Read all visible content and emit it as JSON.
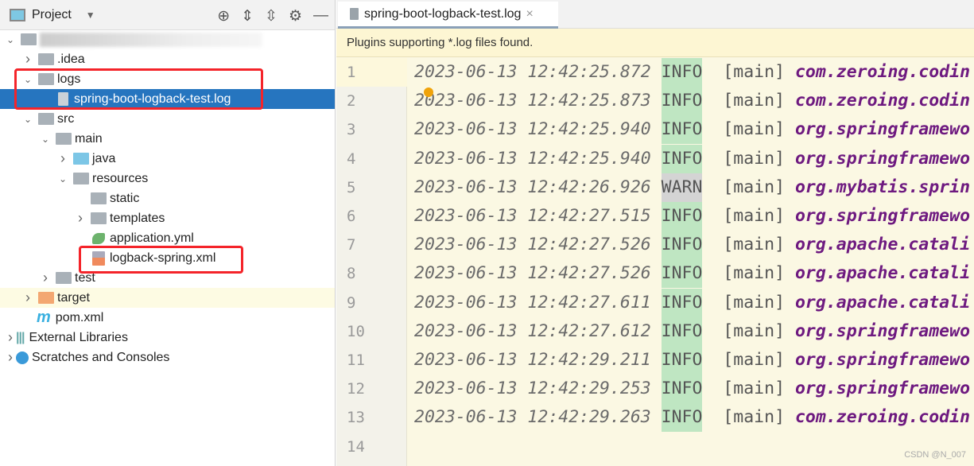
{
  "project": {
    "title": "Project",
    "tools": [
      "locate-icon",
      "expand-all-icon",
      "collapse-all-icon",
      "gear-icon",
      "minimize-icon"
    ],
    "tree": [
      {
        "label": "",
        "depth": 0,
        "chev": "down",
        "icon": "module",
        "blurred": true
      },
      {
        "label": ".idea",
        "depth": 1,
        "chev": "right",
        "icon": "folder"
      },
      {
        "label": "logs",
        "depth": 1,
        "chev": "down",
        "icon": "folder"
      },
      {
        "label": "spring-boot-logback-test.log",
        "depth": 2,
        "chev": "",
        "icon": "file",
        "selected": true
      },
      {
        "label": "src",
        "depth": 1,
        "chev": "down",
        "icon": "folder"
      },
      {
        "label": "main",
        "depth": 2,
        "chev": "down",
        "icon": "folder"
      },
      {
        "label": "java",
        "depth": 3,
        "chev": "right",
        "icon": "folder-blue"
      },
      {
        "label": "resources",
        "depth": 3,
        "chev": "down",
        "icon": "folder-resources"
      },
      {
        "label": "static",
        "depth": 4,
        "chev": "",
        "icon": "folder"
      },
      {
        "label": "templates",
        "depth": 4,
        "chev": "right",
        "icon": "folder"
      },
      {
        "label": "application.yml",
        "depth": 4,
        "chev": "",
        "icon": "spring-yml"
      },
      {
        "label": "logback-spring.xml",
        "depth": 4,
        "chev": "",
        "icon": "xml"
      },
      {
        "label": "test",
        "depth": 2,
        "chev": "right",
        "icon": "folder"
      },
      {
        "label": "target",
        "depth": 1,
        "chev": "right",
        "icon": "folder-orange",
        "highlight": true
      },
      {
        "label": "pom.xml",
        "depth": 1,
        "chev": "",
        "icon": "maven"
      },
      {
        "label": "External Libraries",
        "depth": 0,
        "chev": "right",
        "icon": "libraries"
      },
      {
        "label": "Scratches and Consoles",
        "depth": 0,
        "chev": "right",
        "icon": "scratches"
      }
    ]
  },
  "editor": {
    "tab": "spring-boot-logback-test.log",
    "banner": "Plugins supporting *.log files found.",
    "lines": [
      {
        "ts": "2023-06-13 12:42:25.872",
        "level": "INFO",
        "thread": "[main]",
        "cls": "com.zeroing.codin"
      },
      {
        "ts": "2023-06-13 12:42:25.873",
        "level": "INFO",
        "thread": "[main]",
        "cls": "com.zeroing.codin"
      },
      {
        "ts": "2023-06-13 12:42:25.940",
        "level": "INFO",
        "thread": "[main]",
        "cls": "org.springframewo"
      },
      {
        "ts": "2023-06-13 12:42:25.940",
        "level": "INFO",
        "thread": "[main]",
        "cls": "org.springframewo"
      },
      {
        "ts": "2023-06-13 12:42:26.926",
        "level": "WARN",
        "thread": "[main]",
        "cls": "org.mybatis.sprin"
      },
      {
        "ts": "2023-06-13 12:42:27.515",
        "level": "INFO",
        "thread": "[main]",
        "cls": "org.springframewo"
      },
      {
        "ts": "2023-06-13 12:42:27.526",
        "level": "INFO",
        "thread": "[main]",
        "cls": "org.apache.catali"
      },
      {
        "ts": "2023-06-13 12:42:27.526",
        "level": "INFO",
        "thread": "[main]",
        "cls": "org.apache.catali"
      },
      {
        "ts": "2023-06-13 12:42:27.611",
        "level": "INFO",
        "thread": "[main]",
        "cls": "org.apache.catali"
      },
      {
        "ts": "2023-06-13 12:42:27.612",
        "level": "INFO",
        "thread": "[main]",
        "cls": "org.springframewo"
      },
      {
        "ts": "2023-06-13 12:42:29.211",
        "level": "INFO",
        "thread": "[main]",
        "cls": "org.springframewo"
      },
      {
        "ts": "2023-06-13 12:42:29.253",
        "level": "INFO",
        "thread": "[main]",
        "cls": "org.springframewo"
      },
      {
        "ts": "2023-06-13 12:42:29.263",
        "level": "INFO",
        "thread": "[main]",
        "cls": "com.zeroing.codin"
      }
    ],
    "line_count": 14
  },
  "watermark": "CSDN @N_007"
}
